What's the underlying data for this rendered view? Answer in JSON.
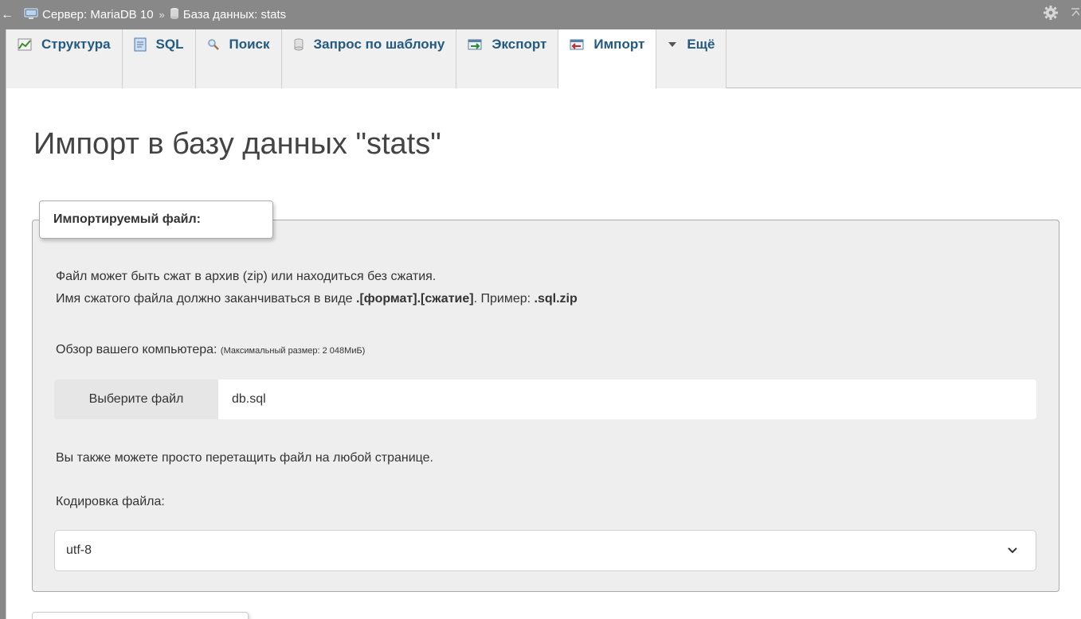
{
  "breadcrumb": {
    "back_glyph": "←",
    "server_label": "Сервер: MariaDB 10",
    "separator": "»",
    "database_label": "База данных: stats"
  },
  "icons": {
    "back": "back-arrow-icon",
    "server": "server-icon",
    "database": "database-icon",
    "settings": "gear-icon",
    "collapse": "collapse-icon"
  },
  "tabs": [
    {
      "label": "Структура",
      "icon": "structure-icon",
      "active": false
    },
    {
      "label": "SQL",
      "icon": "sql-icon",
      "active": false
    },
    {
      "label": "Поиск",
      "icon": "search-icon",
      "active": false
    },
    {
      "label": "Запрос по шаблону",
      "icon": "query-icon",
      "active": false
    },
    {
      "label": "Экспорт",
      "icon": "export-icon",
      "active": false
    },
    {
      "label": "Импорт",
      "icon": "import-icon",
      "active": true
    },
    {
      "label": "Ещё",
      "icon": "dropdown-triangle-icon",
      "active": false
    }
  ],
  "page": {
    "title": "Импорт в базу данных \"stats\""
  },
  "import_file": {
    "legend": "Импортируемый файл:",
    "compress_line1": "Файл может быть сжат в архив (zip) или находиться без сжатия.",
    "compress_line2_prefix": "Имя сжатого файла должно заканчиваться в виде ",
    "compress_line2_format": ".[формат].[сжатие]",
    "compress_line2_middle": ". Пример: ",
    "compress_line2_example": ".sql.zip",
    "browse_label": "Обзор вашего компьютера: ",
    "max_size": "(Максимальный размер: 2 048МиБ)",
    "choose_file_button": "Выберите файл",
    "chosen_file": "db.sql",
    "drag_hint": "Вы также можете просто перетащить файл на любой странице.",
    "charset_label": "Кодировка файла:",
    "charset_value": "utf-8"
  },
  "colors": {
    "topbar": "#888888",
    "tab_text": "#235a81",
    "fieldset_bg": "#eeeeee",
    "title": "#444444"
  }
}
